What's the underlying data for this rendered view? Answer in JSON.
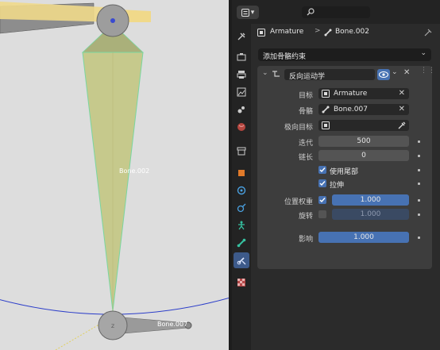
{
  "viewport": {
    "bone_label": "Bone.002",
    "bone_label_2": "Bone.007"
  },
  "header": {
    "armature": "Armature",
    "separator": ">",
    "bone": "Bone.002"
  },
  "add_constraint_label": "添加骨骼约束",
  "constraint": {
    "name": "反向运动学",
    "target_label": "目标",
    "target_value": "Armature",
    "bone_label": "骨骼",
    "bone_value": "Bone.007",
    "pole_label": "极向目标",
    "iterations_label": "迭代",
    "iterations_value": "500",
    "chain_length_label": "链长",
    "chain_length_value": "0",
    "use_tail_label": "使用尾部",
    "stretch_label": "拉伸",
    "position_weight_label": "位置权重",
    "position_weight_value": "1.000",
    "rotation_label": "旋转",
    "rotation_value": "1.000",
    "influence_label": "影响",
    "influence_value": "1.000"
  },
  "colors": {
    "accent": "#4772b3",
    "bone_fill": "#c6c98c",
    "bone_select": "#e6c26a"
  }
}
